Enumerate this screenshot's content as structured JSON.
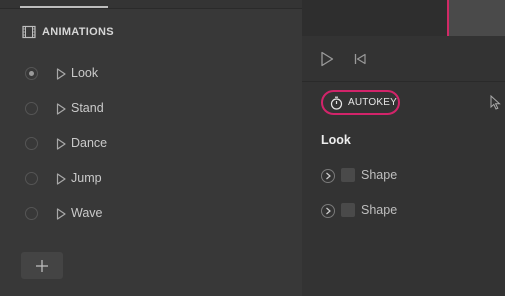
{
  "animations_panel": {
    "title": "ANIMATIONS",
    "items": [
      {
        "label": "Look",
        "selected": true
      },
      {
        "label": "Stand",
        "selected": false
      },
      {
        "label": "Dance",
        "selected": false
      },
      {
        "label": "Jump",
        "selected": false
      },
      {
        "label": "Wave",
        "selected": false
      }
    ],
    "add_label": "+"
  },
  "timeline": {
    "autokey_label": "AUTOKEY",
    "current_animation": "Look",
    "tracks": [
      {
        "label": "Shape"
      },
      {
        "label": "Shape"
      }
    ]
  },
  "colors": {
    "accent": "#d2246a",
    "panel_bg": "#383838",
    "timeline_bg": "#333333"
  }
}
